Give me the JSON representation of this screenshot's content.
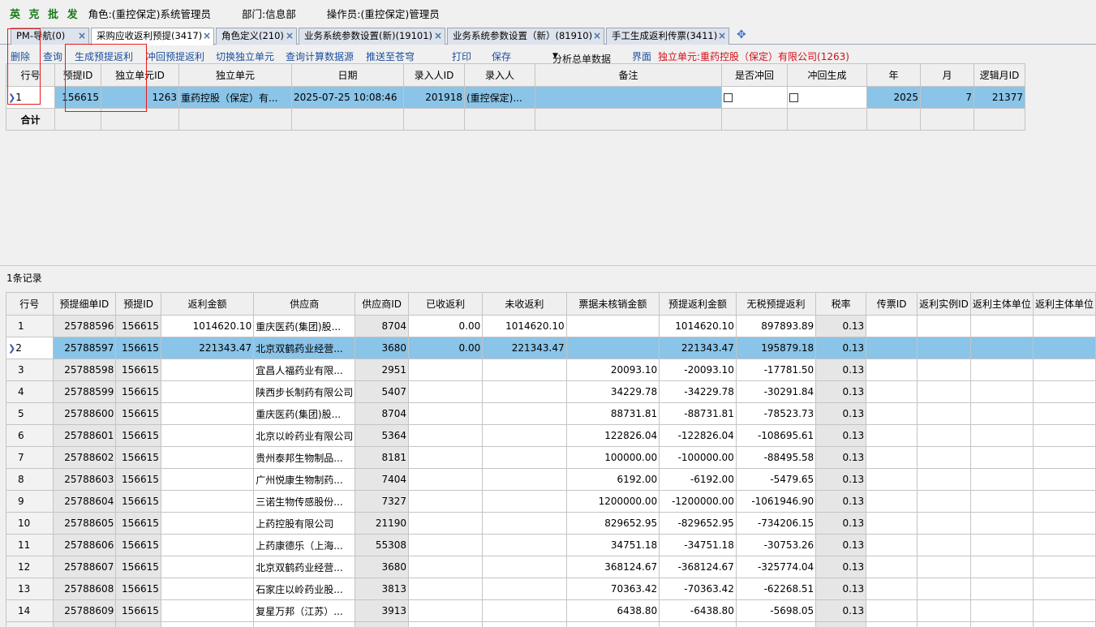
{
  "header": {
    "brand": "英 克 批 发",
    "role": "角色:(重控保定)系统管理员",
    "department": "部门:信息部",
    "operator": "操作员:(重控保定)管理员"
  },
  "tabs": [
    {
      "label": "PM-导航(0)"
    },
    {
      "label": "采购应收返利预提(3417)"
    },
    {
      "label": "角色定义(210)"
    },
    {
      "label": "业务系统参数设置(新)(19101)"
    },
    {
      "label": "业务系统参数设置（新）(81910)"
    },
    {
      "label": "手工生成返利传票(3411)"
    }
  ],
  "toolbar": {
    "delete": "删除",
    "query": "查询",
    "generate": "生成预提返利",
    "reverse": "冲回预提返利",
    "switch_unit": "切换独立单元",
    "query_source": "查询计算数据源",
    "push": "推送至苍穹",
    "print": "打印",
    "save": "保存",
    "analysis": "分析总单数据",
    "ui": "界面",
    "current_unit": "独立单元:重药控股（保定）有限公司(1263)"
  },
  "master_grid": {
    "columns": [
      "行号",
      "预提ID",
      "独立单元ID",
      "独立单元",
      "日期",
      "录入人ID",
      "录入人",
      "备注",
      "是否冲回",
      "冲回生成",
      "年",
      "月",
      "逻辑月ID"
    ],
    "rows": [
      {
        "row": "1",
        "id": "156615",
        "unit_id": "1263",
        "unit": "重药控股（保定）有...",
        "date": "2025-07-25 10:08:46",
        "user_id": "201918",
        "user": "(重控保定)...",
        "remark": "",
        "year": "2025",
        "month": "7",
        "logic_month": "21377"
      }
    ],
    "sum_label": "合计"
  },
  "record_count": "1条记录",
  "detail_grid": {
    "columns": [
      "行号",
      "预提细单ID",
      "预提ID",
      "返利金额",
      "供应商",
      "供应商ID",
      "已收返利",
      "未收返利",
      "票据未核销金额",
      "预提返利金额",
      "无税预提返利",
      "税率",
      "传票ID",
      "返利实例ID",
      "返利主体单位",
      "返利主体单位"
    ],
    "rows": [
      {
        "row": "1",
        "detail_id": "25788596",
        "id": "156615",
        "amount": "1014620.10",
        "supplier": "重庆医药(集团)股...",
        "supplier_id": "8704",
        "received": "0.00",
        "unreceived": "1014620.10",
        "unverified": "",
        "accrued": "1014620.10",
        "untaxed": "897893.89",
        "tax": "0.13"
      },
      {
        "row": "2",
        "detail_id": "25788597",
        "id": "156615",
        "amount": "221343.47",
        "supplier": "北京双鹤药业经营...",
        "supplier_id": "3680",
        "received": "0.00",
        "unreceived": "221343.47",
        "unverified": "",
        "accrued": "221343.47",
        "untaxed": "195879.18",
        "tax": "0.13"
      },
      {
        "row": "3",
        "detail_id": "25788598",
        "id": "156615",
        "amount": "",
        "supplier": "宜昌人福药业有限...",
        "supplier_id": "2951",
        "received": "",
        "unreceived": "",
        "unverified": "20093.10",
        "accrued": "-20093.10",
        "untaxed": "-17781.50",
        "tax": "0.13"
      },
      {
        "row": "4",
        "detail_id": "25788599",
        "id": "156615",
        "amount": "",
        "supplier": "陕西步长制药有限公司",
        "supplier_id": "5407",
        "received": "",
        "unreceived": "",
        "unverified": "34229.78",
        "accrued": "-34229.78",
        "untaxed": "-30291.84",
        "tax": "0.13"
      },
      {
        "row": "5",
        "detail_id": "25788600",
        "id": "156615",
        "amount": "",
        "supplier": "重庆医药(集团)股...",
        "supplier_id": "8704",
        "received": "",
        "unreceived": "",
        "unverified": "88731.81",
        "accrued": "-88731.81",
        "untaxed": "-78523.73",
        "tax": "0.13"
      },
      {
        "row": "6",
        "detail_id": "25788601",
        "id": "156615",
        "amount": "",
        "supplier": "北京以岭药业有限公司",
        "supplier_id": "5364",
        "received": "",
        "unreceived": "",
        "unverified": "122826.04",
        "accrued": "-122826.04",
        "untaxed": "-108695.61",
        "tax": "0.13"
      },
      {
        "row": "7",
        "detail_id": "25788602",
        "id": "156615",
        "amount": "",
        "supplier": "贵州泰邦生物制品...",
        "supplier_id": "8181",
        "received": "",
        "unreceived": "",
        "unverified": "100000.00",
        "accrued": "-100000.00",
        "untaxed": "-88495.58",
        "tax": "0.13"
      },
      {
        "row": "8",
        "detail_id": "25788603",
        "id": "156615",
        "amount": "",
        "supplier": "广州悦康生物制药...",
        "supplier_id": "7404",
        "received": "",
        "unreceived": "",
        "unverified": "6192.00",
        "accrued": "-6192.00",
        "untaxed": "-5479.65",
        "tax": "0.13"
      },
      {
        "row": "9",
        "detail_id": "25788604",
        "id": "156615",
        "amount": "",
        "supplier": "三诺生物传感股份...",
        "supplier_id": "7327",
        "received": "",
        "unreceived": "",
        "unverified": "1200000.00",
        "accrued": "-1200000.00",
        "untaxed": "-1061946.90",
        "tax": "0.13"
      },
      {
        "row": "10",
        "detail_id": "25788605",
        "id": "156615",
        "amount": "",
        "supplier": "上药控股有限公司",
        "supplier_id": "21190",
        "received": "",
        "unreceived": "",
        "unverified": "829652.95",
        "accrued": "-829652.95",
        "untaxed": "-734206.15",
        "tax": "0.13"
      },
      {
        "row": "11",
        "detail_id": "25788606",
        "id": "156615",
        "amount": "",
        "supplier": "上药康德乐（上海...",
        "supplier_id": "55308",
        "received": "",
        "unreceived": "",
        "unverified": "34751.18",
        "accrued": "-34751.18",
        "untaxed": "-30753.26",
        "tax": "0.13"
      },
      {
        "row": "12",
        "detail_id": "25788607",
        "id": "156615",
        "amount": "",
        "supplier": "北京双鹤药业经营...",
        "supplier_id": "3680",
        "received": "",
        "unreceived": "",
        "unverified": "368124.67",
        "accrued": "-368124.67",
        "untaxed": "-325774.04",
        "tax": "0.13"
      },
      {
        "row": "13",
        "detail_id": "25788608",
        "id": "156615",
        "amount": "",
        "supplier": "石家庄以岭药业股...",
        "supplier_id": "3813",
        "received": "",
        "unreceived": "",
        "unverified": "70363.42",
        "accrued": "-70363.42",
        "untaxed": "-62268.51",
        "tax": "0.13"
      },
      {
        "row": "14",
        "detail_id": "25788609",
        "id": "156615",
        "amount": "",
        "supplier": "复星万邦（江苏）...",
        "supplier_id": "3913",
        "received": "",
        "unreceived": "",
        "unverified": "6438.80",
        "accrued": "-6438.80",
        "untaxed": "-5698.05",
        "tax": "0.13"
      },
      {
        "row": "",
        "detail_id": "",
        "id": "",
        "amount": "",
        "supplier": "",
        "supplier_id": "",
        "received": "",
        "unreceived": "",
        "unverified": "",
        "accrued": "",
        "untaxed": "",
        "tax": ""
      }
    ]
  }
}
